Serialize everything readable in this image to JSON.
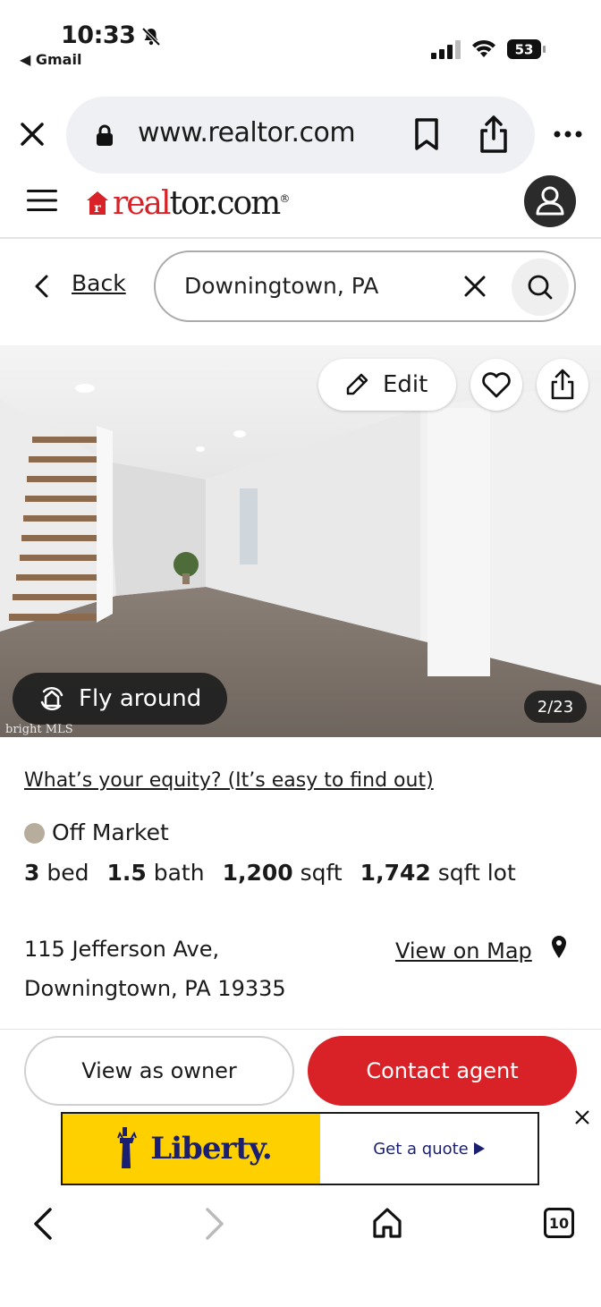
{
  "status_bar": {
    "time": "10:33",
    "back_app": "◀ Gmail",
    "battery": "53",
    "icons": [
      "bell-muted-icon",
      "signal-icon",
      "wifi-icon",
      "battery-icon"
    ]
  },
  "browser": {
    "url": "www.realtor.com",
    "icons": [
      "close-icon",
      "lock-icon",
      "bookmark-icon",
      "share-icon",
      "more-icon"
    ]
  },
  "site_header": {
    "logo_red": "real",
    "logo_dark": "tor.com",
    "logo_mark": "®",
    "icons": [
      "menu-icon",
      "user-icon"
    ]
  },
  "search_row": {
    "back_label": "Back",
    "search_value": "Downingtown, PA",
    "icons": [
      "chevron-left-icon",
      "clear-icon",
      "search-icon"
    ]
  },
  "photo": {
    "edit_label": "Edit",
    "fly_label": "Fly around",
    "counter": "2/23",
    "watermark": "bright MLS",
    "icons": [
      "pencil-icon",
      "heart-icon",
      "share-icon",
      "fly-around-icon"
    ]
  },
  "listing": {
    "equity_link": "What’s your equity? (It’s easy to find out)",
    "status": "Off Market",
    "status_color": "#b7ad9d",
    "beds_value": "3",
    "beds_unit": "bed",
    "baths_value": "1.5",
    "baths_unit": "bath",
    "sqft_value": "1,200",
    "sqft_unit": "sqft",
    "lot_value": "1,742",
    "lot_unit": "sqft lot",
    "address_line1": "115 Jefferson Ave,",
    "address_line2": "Downingtown, PA 19335",
    "map_link": "View on Map"
  },
  "actions": {
    "owner_label": "View as owner",
    "agent_label": "Contact agent",
    "agent_color": "#d92228"
  },
  "ad": {
    "brand": "Liberty.",
    "cta": "Get a quote"
  },
  "nav": {
    "tab_count": "10",
    "icons": [
      "back-icon",
      "forward-icon",
      "home-icon",
      "tabs-icon"
    ]
  }
}
